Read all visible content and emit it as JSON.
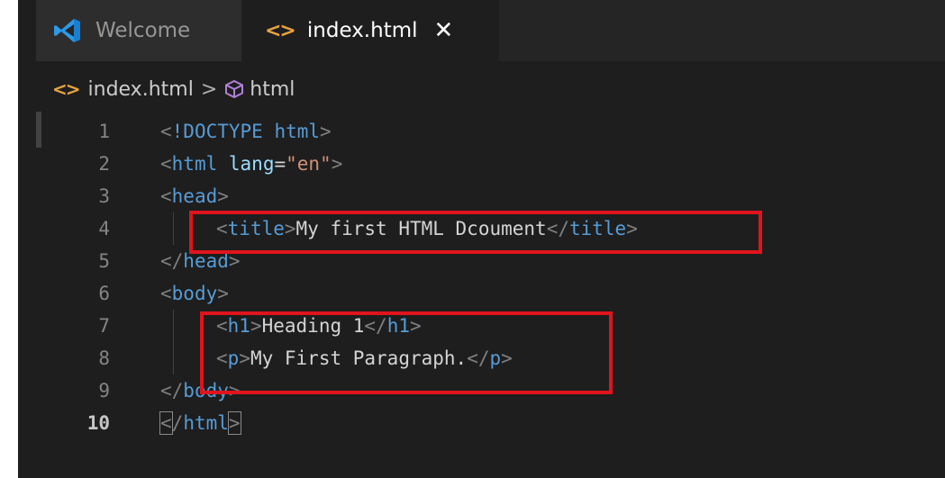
{
  "tabs": [
    {
      "label": "Welcome",
      "icon": "vscode-logo-icon",
      "active": false
    },
    {
      "label": "index.html",
      "icon": "html-file-icon",
      "active": true,
      "close": "✕"
    }
  ],
  "breadcrumb": {
    "file": "index.html",
    "separator": ">",
    "symbol": "html"
  },
  "editor": {
    "lines": [
      {
        "n": "1",
        "text": "<!DOCTYPE html>"
      },
      {
        "n": "2",
        "text": "<html lang=\"en\">"
      },
      {
        "n": "3",
        "text": "<head>"
      },
      {
        "n": "4",
        "text": "<title>My first HTML Dcoument</title>"
      },
      {
        "n": "5",
        "text": "</head>"
      },
      {
        "n": "6",
        "text": "<body>"
      },
      {
        "n": "7",
        "text": "<h1>Heading 1</h1>"
      },
      {
        "n": "8",
        "text": "<p>My First Paragraph.</p>"
      },
      {
        "n": "9",
        "text": "</body>"
      },
      {
        "n": "10",
        "text": "</html>"
      }
    ],
    "current_line": "10"
  },
  "colors": {
    "highlight_box": "#e0141c",
    "tag": "#569cd6",
    "attribute": "#9cdcfe",
    "string": "#ce9178",
    "text": "#d4d4d4"
  }
}
